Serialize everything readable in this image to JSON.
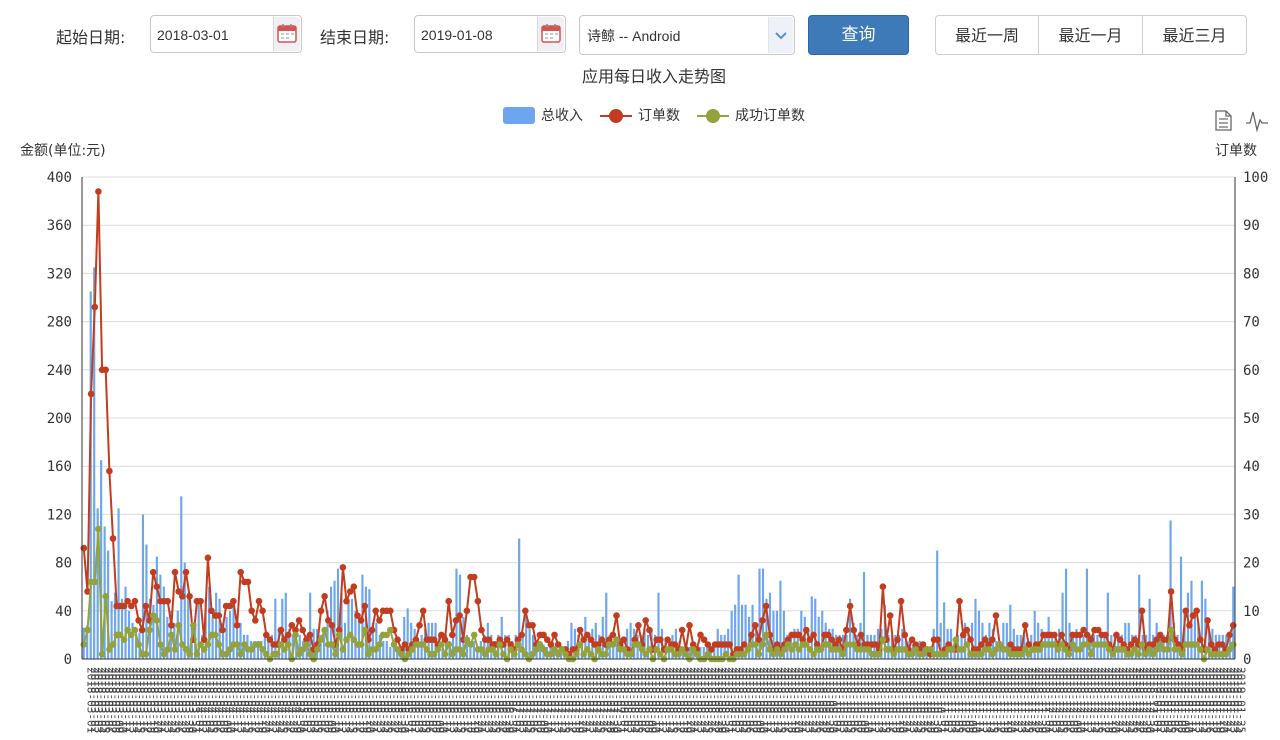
{
  "filters": {
    "start_label": "起始日期:",
    "start_value": "2018-03-01",
    "end_label": "结束日期:",
    "end_value": "2019-01-08",
    "app_selected": "诗鲸 -- Android",
    "query_label": "查询",
    "quick_ranges": [
      "最近一周",
      "最近一月",
      "最近三月"
    ]
  },
  "colors": {
    "bar": "#6ea6ee",
    "orders": "#c23d1f",
    "success": "#93a23a",
    "grid": "#dcdcdc",
    "primary": "#3f7ab8"
  },
  "toolbox": {
    "icons": [
      "data-view-icon",
      "line-toggle-icon"
    ]
  },
  "chart_data": {
    "type": "bar+line",
    "title": "应用每日收入走势图",
    "ylabel_left": "金额(单位:元)",
    "ylabel_right": "订单数",
    "ylim_left": [
      0,
      400
    ],
    "ylim_right": [
      0,
      100
    ],
    "yticks_left": [
      0,
      40,
      80,
      120,
      160,
      200,
      240,
      280,
      320,
      360,
      400
    ],
    "yticks_right": [
      0,
      10,
      20,
      30,
      40,
      50,
      60,
      70,
      80,
      90,
      100
    ],
    "legend": [
      "总收入",
      "订单数",
      "成功订单数"
    ],
    "legend_position": "top-center",
    "x_start": "2018-03-01",
    "x_end": "2019-01-08",
    "series": [
      {
        "name": "总收入",
        "axis": "left",
        "type": "bar",
        "values": [
          26,
          28,
          305,
          325,
          125,
          165,
          110,
          90,
          48,
          55,
          125,
          50,
          60,
          40,
          30,
          25,
          22,
          120,
          95,
          50,
          45,
          85,
          70,
          60,
          35,
          40,
          30,
          40,
          135,
          80,
          55,
          30,
          30,
          50,
          20,
          50,
          60,
          35,
          55,
          50,
          30,
          35,
          40,
          45,
          30,
          30,
          20,
          20,
          15,
          15,
          15,
          15,
          20,
          20,
          20,
          50,
          25,
          50,
          55,
          25,
          20,
          15,
          20,
          15,
          20,
          55,
          25,
          25,
          20,
          25,
          40,
          60,
          65,
          75,
          55,
          30,
          50,
          50,
          40,
          35,
          70,
          60,
          58,
          30,
          30,
          20,
          15,
          15,
          10,
          10,
          10,
          10,
          35,
          42,
          30,
          25,
          15,
          20,
          25,
          30,
          30,
          30,
          20,
          15,
          20,
          15,
          25,
          75,
          70,
          35,
          20,
          15,
          15,
          10,
          15,
          20,
          30,
          20,
          15,
          20,
          35,
          20,
          20,
          15,
          20,
          100,
          20,
          40,
          25,
          20,
          15,
          15,
          12,
          10,
          10,
          10,
          8,
          5,
          5,
          15,
          30,
          25,
          20,
          15,
          35,
          20,
          25,
          30,
          20,
          35,
          55,
          20,
          15,
          15,
          10,
          10,
          25,
          30,
          25,
          20,
          20,
          25,
          20,
          25,
          20,
          55,
          25,
          15,
          10,
          20,
          25,
          15,
          10,
          10,
          10,
          10,
          10,
          10,
          10,
          10,
          10,
          10,
          25,
          20,
          20,
          25,
          40,
          45,
          70,
          45,
          45,
          35,
          45,
          30,
          75,
          75,
          50,
          55,
          40,
          40,
          65,
          40,
          20,
          20,
          25,
          25,
          40,
          35,
          25,
          52,
          50,
          35,
          40,
          30,
          25,
          25,
          20,
          20,
          20,
          20,
          50,
          30,
          20,
          30,
          72,
          20,
          20,
          20,
          25,
          25,
          45,
          20,
          20,
          20,
          20,
          25,
          15,
          15,
          12,
          10,
          15,
          10,
          10,
          10,
          25,
          90,
          30,
          47,
          25,
          25,
          15,
          20,
          20,
          30,
          25,
          30,
          50,
          40,
          30,
          20,
          30,
          25,
          15,
          15,
          30,
          30,
          45,
          25,
          20,
          20,
          20,
          15,
          20,
          40,
          30,
          25,
          20,
          35,
          20,
          20,
          25,
          55,
          75,
          30,
          20,
          25,
          20,
          20,
          75,
          20,
          20,
          20,
          20,
          20,
          55,
          20,
          20,
          20,
          20,
          30,
          30,
          20,
          20,
          70,
          20,
          20,
          50,
          20,
          30,
          20,
          20,
          20,
          115,
          30,
          20,
          85,
          40,
          55,
          65,
          35,
          30,
          65,
          50,
          25,
          25,
          20,
          20,
          20,
          20,
          20,
          60
        ]
      },
      {
        "name": "订单数",
        "axis": "right",
        "type": "line",
        "values": [
          23,
          14,
          55,
          73,
          97,
          60,
          60,
          39,
          25,
          11,
          11,
          11,
          12,
          11,
          12,
          8,
          6,
          11,
          8,
          18,
          15,
          12,
          12,
          12,
          7,
          18,
          14,
          13,
          18,
          13,
          4,
          12,
          12,
          4,
          21,
          10,
          9,
          9,
          6,
          11,
          11,
          12,
          7,
          18,
          16,
          16,
          10,
          8,
          12,
          10,
          5,
          4,
          3,
          3,
          6,
          4,
          5,
          7,
          6,
          8,
          6,
          4,
          5,
          2,
          3,
          10,
          13,
          8,
          7,
          3,
          6,
          19,
          12,
          14,
          15,
          9,
          8,
          11,
          4,
          6,
          10,
          8,
          10,
          10,
          10,
          6,
          4,
          2,
          3,
          2,
          3,
          4,
          7,
          10,
          4,
          4,
          4,
          3,
          5,
          4,
          12,
          5,
          8,
          9,
          4,
          10,
          17,
          17,
          12,
          6,
          4,
          4,
          3,
          3,
          4,
          3,
          4,
          3,
          2,
          4,
          5,
          10,
          7,
          7,
          3,
          5,
          5,
          4,
          3,
          5,
          3,
          2,
          2,
          1,
          2,
          2,
          6,
          4,
          5,
          4,
          3,
          3,
          4,
          3,
          4,
          5,
          9,
          3,
          4,
          2,
          1,
          4,
          7,
          3,
          8,
          6,
          2,
          4,
          4,
          2,
          4,
          3,
          3,
          2,
          6,
          2,
          7,
          3,
          2,
          5,
          4,
          3,
          2,
          3,
          3,
          3,
          3,
          3,
          1,
          2,
          2,
          3,
          2,
          5,
          7,
          4,
          8,
          11,
          5,
          2,
          3,
          2,
          3,
          4,
          5,
          5,
          5,
          4,
          6,
          4,
          5,
          3,
          2,
          5,
          5,
          4,
          3,
          4,
          2,
          6,
          11,
          6,
          3,
          5,
          3,
          3,
          3,
          3,
          2,
          15,
          4,
          9,
          2,
          4,
          12,
          5,
          2,
          4,
          3,
          2,
          3,
          2,
          1,
          4,
          4,
          1,
          2,
          3,
          2,
          2,
          12,
          5,
          6,
          4,
          2,
          2,
          3,
          4,
          3,
          4,
          9,
          3,
          2,
          2,
          3,
          2,
          2,
          2,
          7,
          3,
          2,
          3,
          3,
          5,
          5,
          5,
          5,
          3,
          5,
          3,
          2,
          5,
          5,
          5,
          6,
          5,
          4,
          6,
          6,
          5,
          5,
          3,
          2,
          5,
          4,
          3,
          2,
          3,
          4,
          3,
          10,
          2,
          3,
          3,
          4,
          5,
          4,
          4,
          14,
          4,
          3,
          2,
          10,
          7,
          9,
          10,
          4,
          2,
          8,
          3,
          2,
          3,
          3,
          2,
          5,
          7
        ]
      },
      {
        "name": "成功订单数",
        "axis": "right",
        "type": "line",
        "values": [
          3,
          6,
          16,
          16,
          27,
          1,
          13,
          2,
          3,
          5,
          5,
          4,
          6,
          5,
          6,
          3,
          1,
          1,
          6,
          9,
          8,
          3,
          1,
          2,
          5,
          2,
          7,
          3,
          2,
          1,
          7,
          1,
          3,
          2,
          3,
          5,
          5,
          3,
          1,
          1,
          2,
          3,
          3,
          1,
          3,
          2,
          2,
          3,
          3,
          2,
          1,
          0,
          1,
          1,
          3,
          2,
          3,
          0,
          5,
          1,
          2,
          3,
          1,
          0,
          2,
          4,
          6,
          3,
          3,
          1,
          5,
          2,
          4,
          5,
          4,
          3,
          3,
          6,
          1,
          2,
          2,
          3,
          5,
          5,
          6,
          3,
          2,
          1,
          0,
          1,
          2,
          3,
          3,
          3,
          2,
          1,
          1,
          2,
          3,
          1,
          3,
          1,
          2,
          2,
          1,
          4,
          3,
          5,
          2,
          2,
          1,
          2,
          2,
          1,
          3,
          1,
          0,
          2,
          1,
          3,
          2,
          1,
          0,
          1,
          2,
          3,
          2,
          1,
          1,
          2,
          1,
          2,
          1,
          0,
          0,
          1,
          3,
          1,
          2,
          1,
          0,
          2,
          1,
          1,
          3,
          3,
          4,
          2,
          2,
          1,
          1,
          3,
          3,
          2,
          1,
          2,
          0,
          2,
          1,
          0,
          2,
          2,
          1,
          1,
          2,
          1,
          0,
          2,
          1,
          0,
          0,
          1,
          0,
          0,
          0,
          0,
          1,
          0,
          0,
          1,
          1,
          1,
          2,
          3,
          3,
          1,
          3,
          5,
          2,
          1,
          2,
          1,
          2,
          3,
          2,
          3,
          2,
          3,
          3,
          2,
          1,
          2,
          2,
          3,
          3,
          2,
          2,
          2,
          1,
          3,
          3,
          3,
          2,
          2,
          2,
          2,
          1,
          1,
          1,
          4,
          2,
          2,
          1,
          2,
          2,
          2,
          1,
          1,
          2,
          1,
          1,
          2,
          2,
          1,
          1,
          1,
          1,
          2,
          2,
          4,
          2,
          2,
          3,
          1,
          1,
          1,
          1,
          2,
          2,
          1,
          2,
          3,
          2,
          2,
          1,
          1,
          1,
          1,
          2,
          1,
          2,
          2,
          2,
          3,
          3,
          3,
          3,
          2,
          3,
          2,
          1,
          3,
          2,
          2,
          3,
          3,
          1,
          3,
          3,
          3,
          3,
          2,
          1,
          2,
          2,
          2,
          1,
          1,
          2,
          1,
          3,
          1,
          2,
          1,
          2,
          3,
          2,
          2,
          6,
          2,
          2,
          1,
          3,
          3,
          3,
          3,
          2,
          0,
          2,
          1,
          1,
          1,
          1,
          1,
          2,
          3
        ]
      }
    ]
  }
}
